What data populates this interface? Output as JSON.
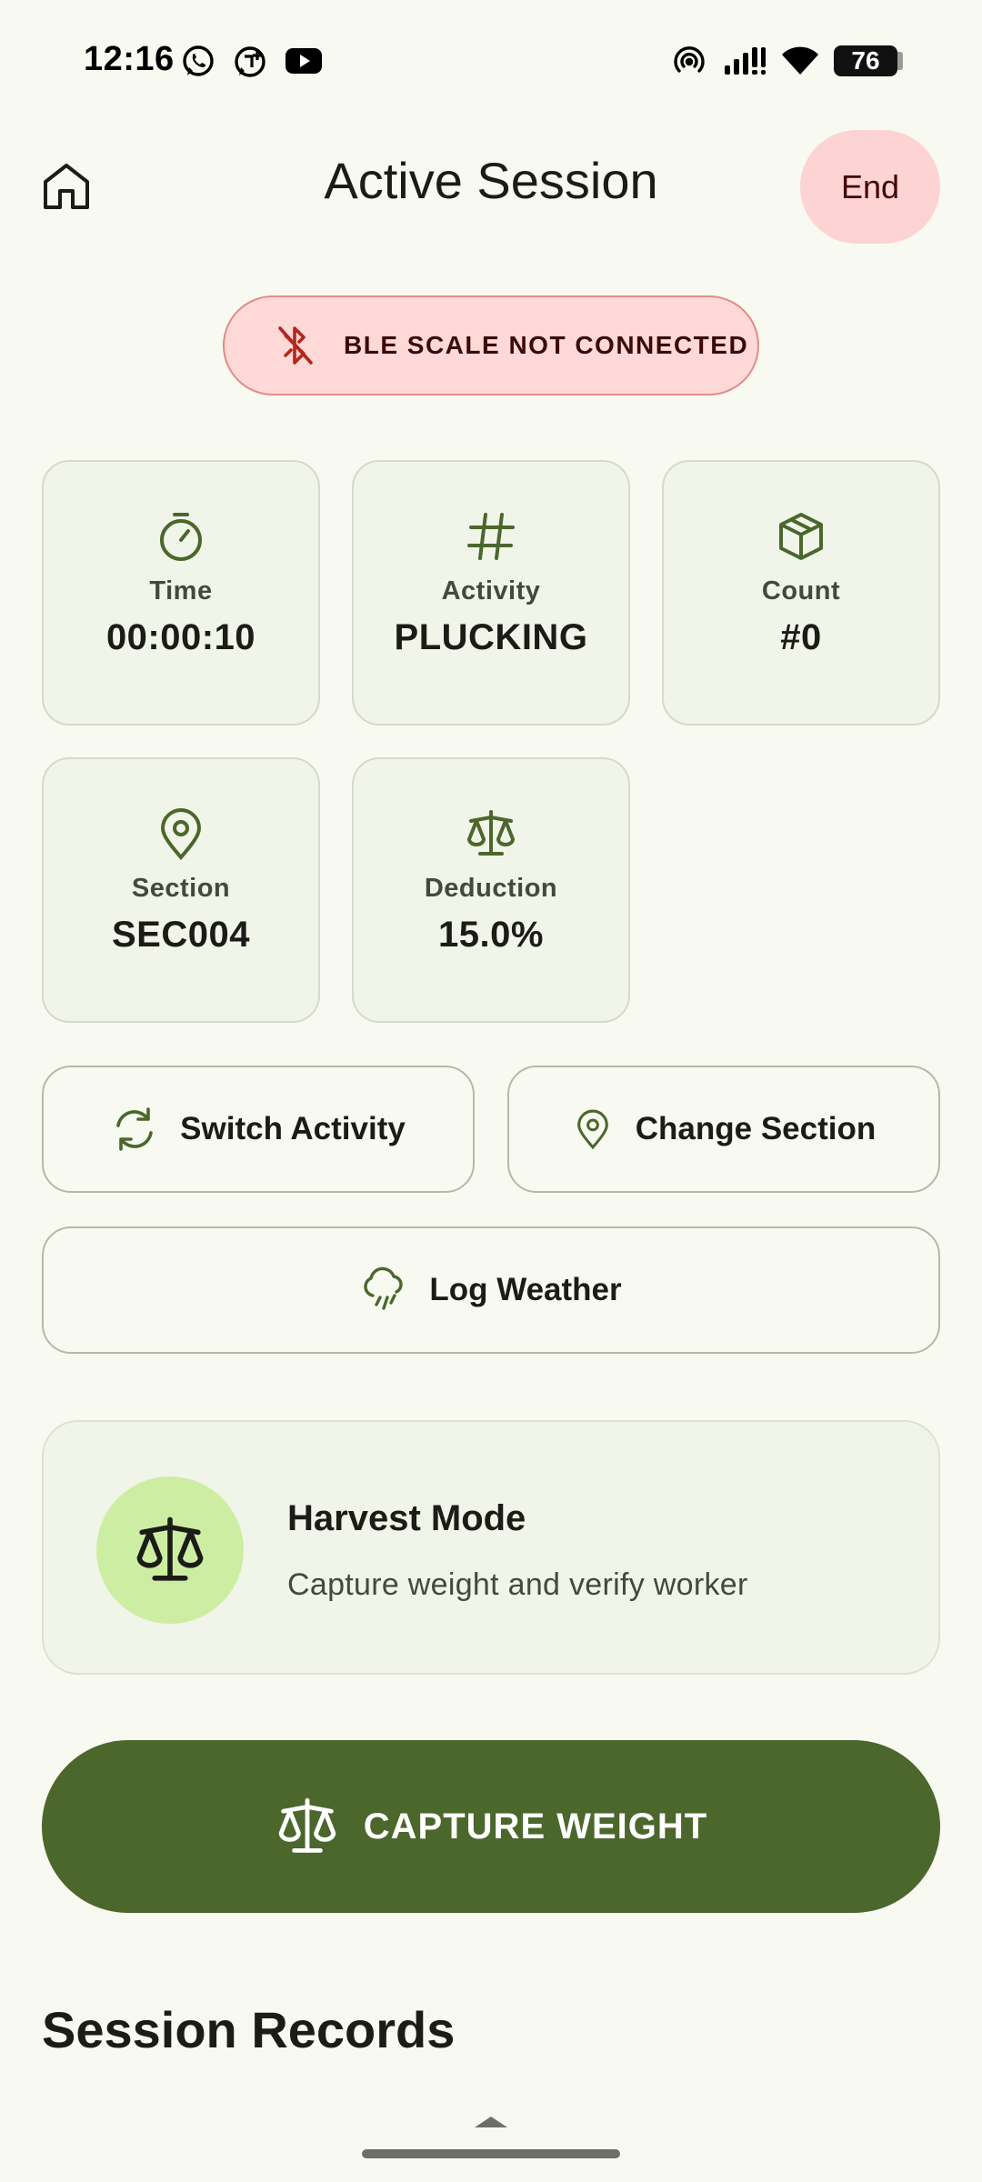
{
  "status_bar": {
    "time": "12:16",
    "battery": "76",
    "notification_icons": [
      "whatsapp-icon",
      "whatsapp-business-icon",
      "youtube-icon"
    ],
    "system_icons": [
      "hotspot-icon",
      "signal-icon",
      "wifi-icon",
      "battery-icon"
    ]
  },
  "header": {
    "title": "Active Session",
    "end_label": "End"
  },
  "ble_banner": {
    "text": "BLE SCALE NOT CONNECTED",
    "icon": "bluetooth-disabled-icon",
    "color": "#ffd9d7"
  },
  "tiles": [
    {
      "label": "Time",
      "value": "00:00:10",
      "icon": "timer-icon"
    },
    {
      "label": "Activity",
      "value": "PLUCKING",
      "icon": "hash-icon"
    },
    {
      "label": "Count",
      "value": "#0",
      "icon": "box-icon"
    },
    {
      "label": "Section",
      "value": "SEC004",
      "icon": "location-pin-icon"
    },
    {
      "label": "Deduction",
      "value": "15.0%",
      "icon": "scale-icon"
    }
  ],
  "actions": {
    "switch_activity": "Switch Activity",
    "change_section": "Change Section",
    "log_weather": "Log Weather"
  },
  "harvest": {
    "title": "Harvest Mode",
    "subtitle": "Capture weight and verify worker"
  },
  "capture": {
    "label": "CAPTURE WEIGHT",
    "color": "#4b672c"
  },
  "records": {
    "title": "Session Records"
  },
  "accent": "#4b672c"
}
